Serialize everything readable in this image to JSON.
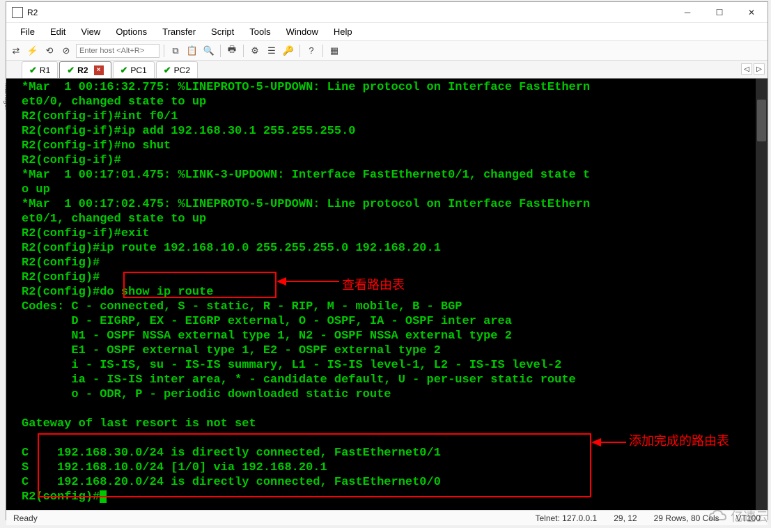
{
  "window": {
    "title": "R2"
  },
  "menu": {
    "file": "File",
    "edit": "Edit",
    "view": "View",
    "options": "Options",
    "transfer": "Transfer",
    "script": "Script",
    "tools": "Tools",
    "window": "Window",
    "help": "Help"
  },
  "toolbar": {
    "host_placeholder": "Enter host <Alt+R>"
  },
  "sidebar": {
    "label": "Session Manager"
  },
  "tabs": {
    "t1": "R1",
    "t2": "R2",
    "t3": "PC1",
    "t4": "PC2"
  },
  "term": {
    "l1": "*Mar  1 00:16:32.775: %LINEPROTO-5-UPDOWN: Line protocol on Interface FastEthern",
    "l2": "et0/0, changed state to up",
    "l3": "R2(config-if)#int f0/1",
    "l4": "R2(config-if)#ip add 192.168.30.1 255.255.255.0",
    "l5": "R2(config-if)#no shut",
    "l6": "R2(config-if)#",
    "l7": "*Mar  1 00:17:01.475: %LINK-3-UPDOWN: Interface FastEthernet0/1, changed state t",
    "l8": "o up",
    "l9": "*Mar  1 00:17:02.475: %LINEPROTO-5-UPDOWN: Line protocol on Interface FastEthern",
    "l10": "et0/1, changed state to up",
    "l11": "R2(config-if)#exit",
    "l12": "R2(config)#ip route 192.168.10.0 255.255.255.0 192.168.20.1",
    "l13": "R2(config)#",
    "l14": "R2(config)#",
    "l15": "R2(config)#do show ip route",
    "l16": "Codes: C - connected, S - static, R - RIP, M - mobile, B - BGP",
    "l17": "       D - EIGRP, EX - EIGRP external, O - OSPF, IA - OSPF inter area",
    "l18": "       N1 - OSPF NSSA external type 1, N2 - OSPF NSSA external type 2",
    "l19": "       E1 - OSPF external type 1, E2 - OSPF external type 2",
    "l20": "       i - IS-IS, su - IS-IS summary, L1 - IS-IS level-1, L2 - IS-IS level-2",
    "l21": "       ia - IS-IS inter area, * - candidate default, U - per-user static route",
    "l22": "       o - ODR, P - periodic downloaded static route",
    "l23": "",
    "l24": "Gateway of last resort is not set",
    "l25": "",
    "l26": "C    192.168.30.0/24 is directly connected, FastEthernet0/1",
    "l27": "S    192.168.10.0/24 [1/0] via 192.168.20.1",
    "l28": "C    192.168.20.0/24 is directly connected, FastEthernet0/0",
    "l29": "R2(config)#"
  },
  "annot": {
    "a1": "查看路由表",
    "a2": "添加完成的路由表"
  },
  "status": {
    "ready": "Ready",
    "conn": "Telnet: 127.0.0.1",
    "pos": "29,   12",
    "size": "29 Rows, 80 Cols",
    "term": "VT100"
  },
  "watermark": "亿速云"
}
